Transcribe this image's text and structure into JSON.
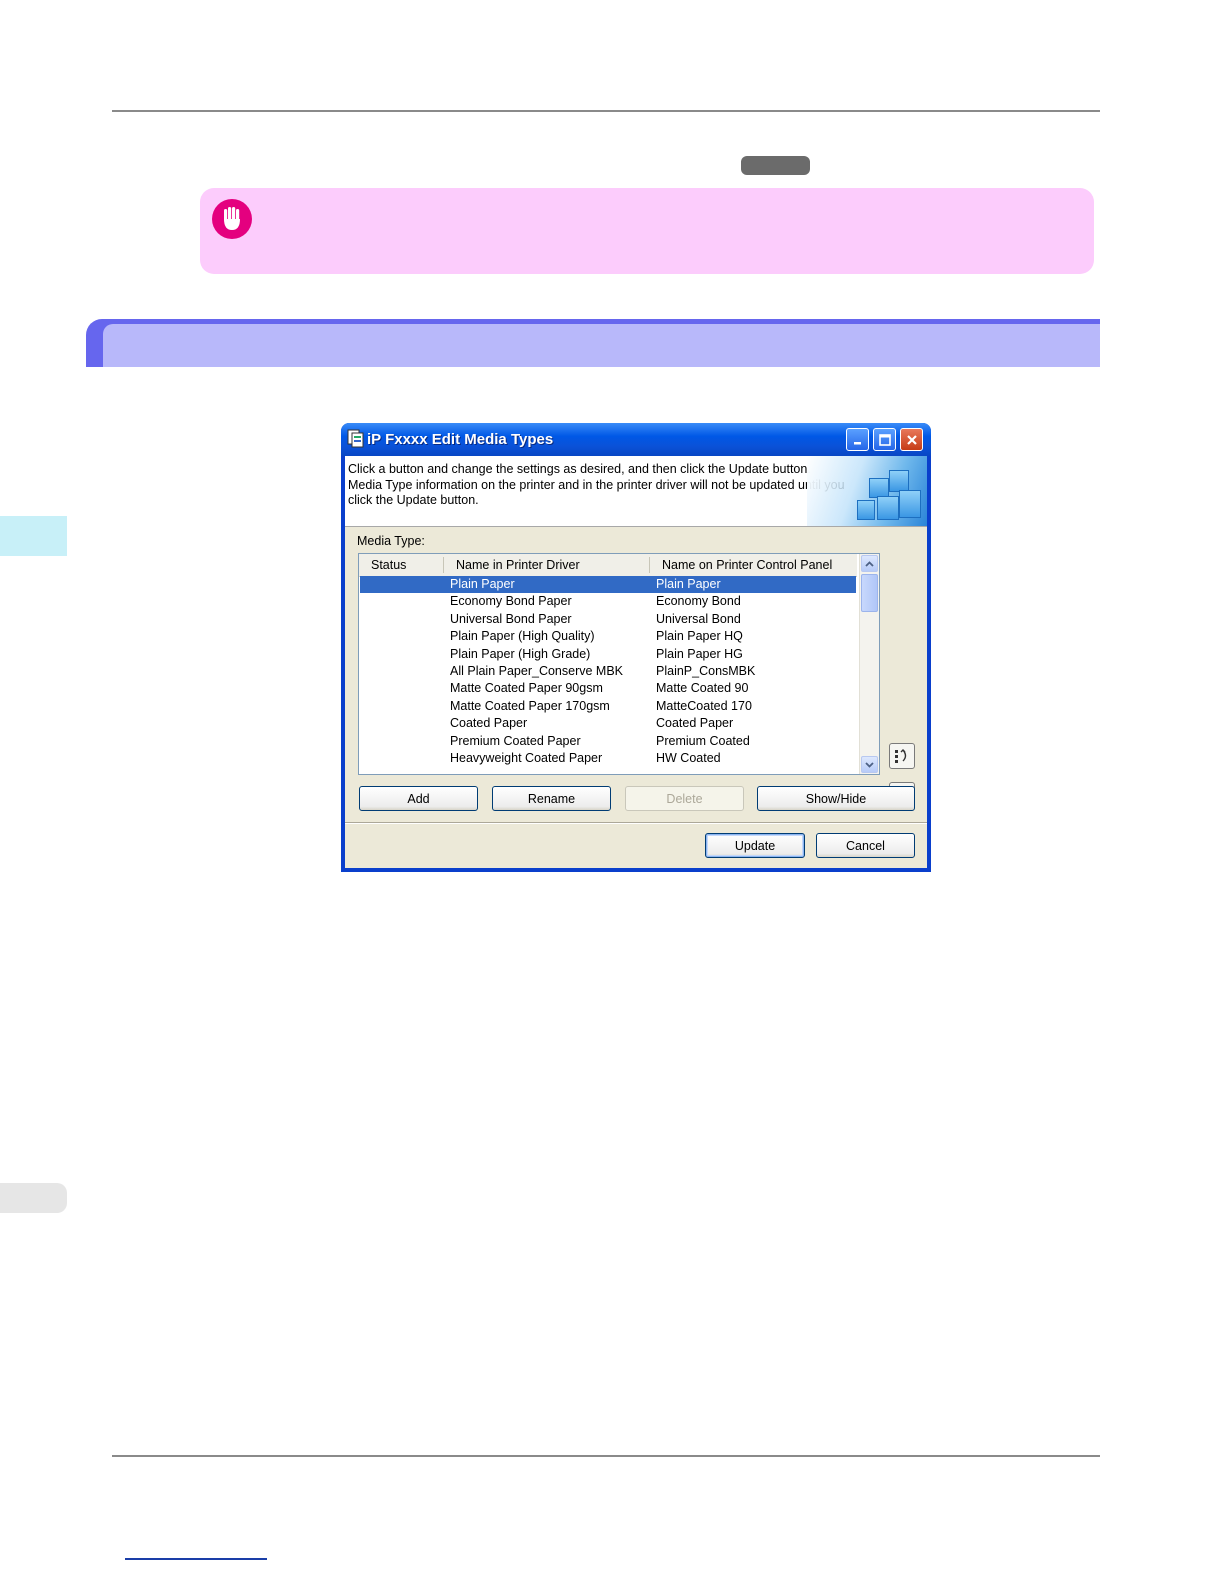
{
  "dialog": {
    "title": "iP Fxxxx Edit Media Types",
    "message": "Click a button and change the settings as desired, and then click the Update button.\nMedia Type information on the printer and in the printer driver will not be updated until you click the Update button.",
    "media_type_label": "Media Type:",
    "columns": [
      "Status",
      "Name in Printer Driver",
      "Name on Printer Control Panel"
    ],
    "rows": [
      {
        "status": "",
        "driver": "Plain Paper",
        "panel": "Plain Paper",
        "selected": true
      },
      {
        "status": "",
        "driver": "Economy Bond Paper",
        "panel": "Economy Bond"
      },
      {
        "status": "",
        "driver": "Universal Bond Paper",
        "panel": "Universal Bond"
      },
      {
        "status": "",
        "driver": "Plain Paper (High Quality)",
        "panel": "Plain Paper HQ"
      },
      {
        "status": "",
        "driver": "Plain Paper (High Grade)",
        "panel": "Plain Paper HG"
      },
      {
        "status": "",
        "driver": "All Plain Paper_Conserve MBK",
        "panel": "PlainP_ConsMBK"
      },
      {
        "status": "",
        "driver": "Matte Coated Paper 90gsm",
        "panel": "Matte Coated 90"
      },
      {
        "status": "",
        "driver": "Matte Coated Paper 170gsm",
        "panel": "MatteCoated 170"
      },
      {
        "status": "",
        "driver": "Coated Paper",
        "panel": "Coated Paper"
      },
      {
        "status": "",
        "driver": "Premium Coated Paper",
        "panel": "Premium Coated"
      },
      {
        "status": "",
        "driver": "Heavyweight Coated Paper",
        "panel": "HW Coated"
      }
    ],
    "buttons": {
      "add": "Add",
      "rename": "Rename",
      "delete": "Delete",
      "show_hide": "Show/Hide",
      "update": "Update",
      "cancel": "Cancel"
    }
  },
  "colors": {
    "note_background": "#fcccfc",
    "section_bar": "#6666ee",
    "selection": "#316ac5"
  }
}
